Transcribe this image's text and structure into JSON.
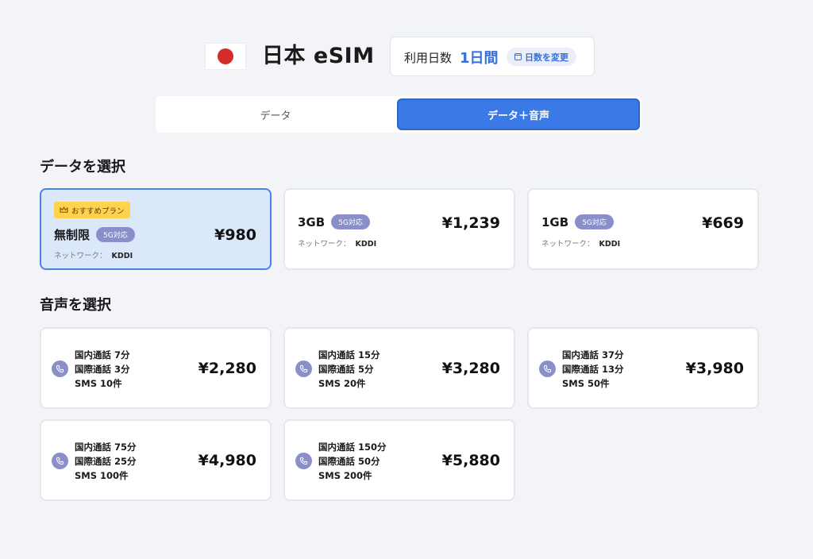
{
  "header": {
    "title": "日本 eSIM",
    "days_label": "利用日数",
    "days_value": "1日間",
    "change_label": "日数を変更"
  },
  "tabs": [
    {
      "label": "データ",
      "active": false
    },
    {
      "label": "データ＋音声",
      "active": true
    }
  ],
  "data_section": {
    "title": "データを選択",
    "plans": [
      {
        "name": "無制限",
        "badge": "5G対応",
        "network_label": "ネットワーク：",
        "network": "KDDI",
        "price": "¥980",
        "recommended": "おすすめプラン",
        "selected": true
      },
      {
        "name": "3GB",
        "badge": "5G対応",
        "network_label": "ネットワーク：",
        "network": "KDDI",
        "price": "¥1,239",
        "selected": false
      },
      {
        "name": "1GB",
        "badge": "5G対応",
        "network_label": "ネットワーク：",
        "network": "KDDI",
        "price": "¥669",
        "selected": false
      }
    ]
  },
  "voice_section": {
    "title": "音声を選択",
    "plans": [
      {
        "domestic": "国内通話 7分",
        "international": "国際通話 3分",
        "sms": "SMS 10件",
        "price": "¥2,280"
      },
      {
        "domestic": "国内通話 15分",
        "international": "国際通話 5分",
        "sms": "SMS 20件",
        "price": "¥3,280"
      },
      {
        "domestic": "国内通話 37分",
        "international": "国際通話 13分",
        "sms": "SMS 50件",
        "price": "¥3,980"
      },
      {
        "domestic": "国内通話 75分",
        "international": "国際通話 25分",
        "sms": "SMS 100件",
        "price": "¥4,980"
      },
      {
        "domestic": "国内通話 150分",
        "international": "国際通話 50分",
        "sms": "SMS 200件",
        "price": "¥5,880"
      }
    ]
  },
  "icons": {
    "flag": "japan-flag-icon",
    "calendar": "calendar-icon",
    "crown": "crown-icon",
    "phone": "phone-icon"
  },
  "colors": {
    "accent": "#3b79e6",
    "selected_bg": "#dbe8f9",
    "badge_5g": "#8a8fc9",
    "recommend": "#ffd34d",
    "flag_red": "#d52b2b"
  }
}
